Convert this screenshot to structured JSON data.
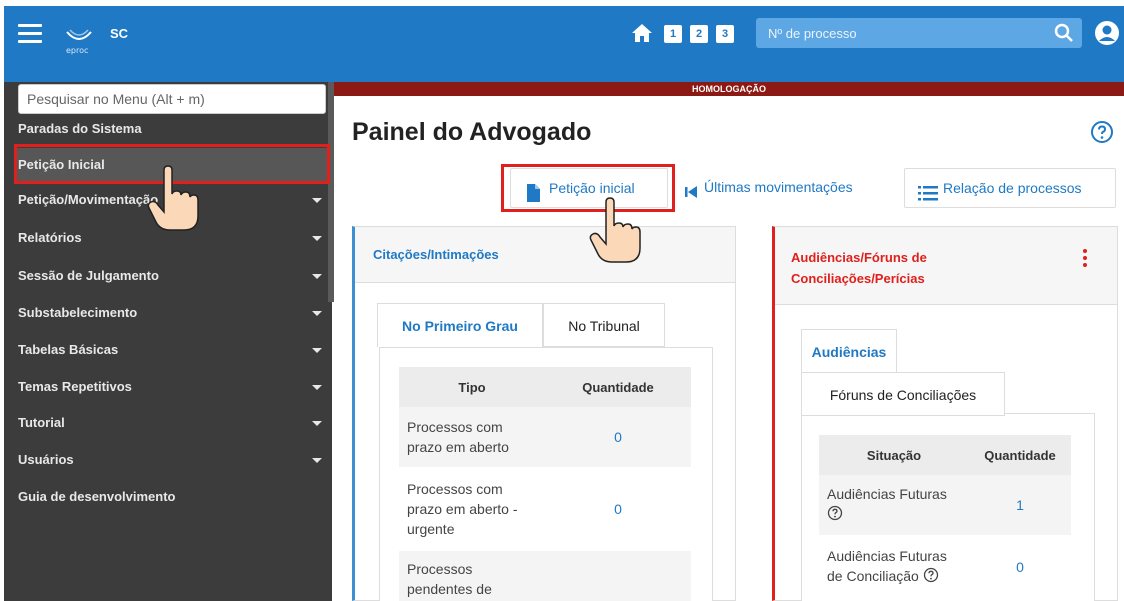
{
  "topbar": {
    "logo_text": "eproc",
    "region": "SC",
    "shortcuts": [
      "1",
      "2",
      "3"
    ],
    "search_placeholder": "Nº de processo"
  },
  "banner": "HOMOLOGAÇÃO",
  "sidebar": {
    "search_placeholder": "Pesquisar no Menu (Alt + m)",
    "items": [
      {
        "label": "Paradas do Sistema",
        "caret": false
      },
      {
        "label": "Petição Inicial",
        "caret": false,
        "active": true
      },
      {
        "label": "Petição/Movimentação",
        "caret": true
      },
      {
        "label": "Relatórios",
        "caret": true
      },
      {
        "label": "Sessão de Julgamento",
        "caret": true
      },
      {
        "label": "Substabelecimento",
        "caret": true
      },
      {
        "label": "Tabelas Básicas",
        "caret": true
      },
      {
        "label": "Temas Repetitivos",
        "caret": true
      },
      {
        "label": "Tutorial",
        "caret": true
      },
      {
        "label": "Usuários",
        "caret": true
      },
      {
        "label": "Guia de desenvolvimento",
        "caret": false
      }
    ]
  },
  "main": {
    "title": "Painel do Advogado",
    "toolbar": {
      "peticao": "Petição inicial",
      "ultimas": "Últimas movimentações",
      "relacao": "Relação de processos"
    },
    "citacoes": {
      "title": "Citações/Intimações",
      "tabs": [
        "No Primeiro Grau",
        "No Tribunal"
      ],
      "headers": [
        "Tipo",
        "Quantidade"
      ],
      "rows": [
        {
          "tipo": "Processos com prazo em aberto",
          "qtd": "0"
        },
        {
          "tipo": "Processos com prazo em aberto - urgente",
          "qtd": "0"
        },
        {
          "tipo": "Processos pendentes de",
          "qtd": ""
        }
      ]
    },
    "audiencias": {
      "title": "Audiências/Fóruns de Conciliações/Perícias",
      "tabs": [
        "Audiências",
        "Fóruns de Conciliações"
      ],
      "headers": [
        "Situação",
        "Quantidade"
      ],
      "rows": [
        {
          "situacao": "Audiências Futuras",
          "qtd": "1"
        },
        {
          "situacao": "Audiências Futuras de Conciliação",
          "qtd": "0"
        }
      ]
    }
  },
  "colors": {
    "topbar": "#1f79c4",
    "sidebar": "#3c3c3c",
    "banner": "#8b1a14",
    "highlight": "#e0201c",
    "link": "#1f79c4"
  }
}
